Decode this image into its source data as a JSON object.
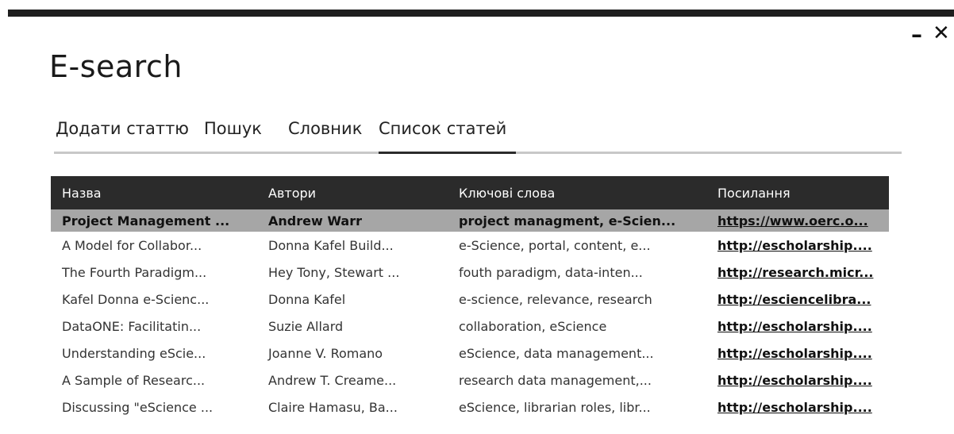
{
  "window": {
    "minimize_label": "–",
    "close_label": "✕"
  },
  "app": {
    "title": "E-search"
  },
  "tabs": [
    {
      "label": "Додати статтю",
      "active": false
    },
    {
      "label": "Пошук",
      "active": false
    },
    {
      "label": "Словник",
      "active": false
    },
    {
      "label": "Список статей",
      "active": true
    }
  ],
  "table": {
    "columns": [
      "Назва",
      "Автори",
      "Ключові слова",
      "Посилання"
    ],
    "rows": [
      [
        "Project Management ...",
        "Andrew Warr",
        "project managment, e-Scien...",
        "https://www.oerc.o..."
      ],
      [
        "A Model for Collabor...",
        "Donna Kafel Build...",
        "e-Science, portal, content, e...",
        "http://escholarship...."
      ],
      [
        "The Fourth Paradigm...",
        "Hey Tony, Stewart ...",
        "fouth paradigm, data-inten...",
        "http://research.micr..."
      ],
      [
        "Kafel Donna e-Scienc...",
        "Donna Kafel",
        "e-science, relevance, research",
        "http://esciencelibra..."
      ],
      [
        "DataONE: Facilitatin...",
        "Suzie Allard",
        "collaboration, eScience",
        "http://escholarship...."
      ],
      [
        "Understanding eScie...",
        "Joanne V. Romano",
        "eScience, data management...",
        "http://escholarship...."
      ],
      [
        "A Sample of Researc...",
        "Andrew T. Creame...",
        "research data management,...",
        "http://escholarship...."
      ],
      [
        "Discussing \"eScience ...",
        "Claire Hamasu, Ba...",
        "eScience, librarian roles, libr...",
        "http://escholarship...."
      ]
    ],
    "selected_row": 0
  },
  "colors": {
    "header_bg": "#2b2b2b",
    "selected_row_bg": "#a6a6a6",
    "tab_underline": "#c8c8c8"
  }
}
